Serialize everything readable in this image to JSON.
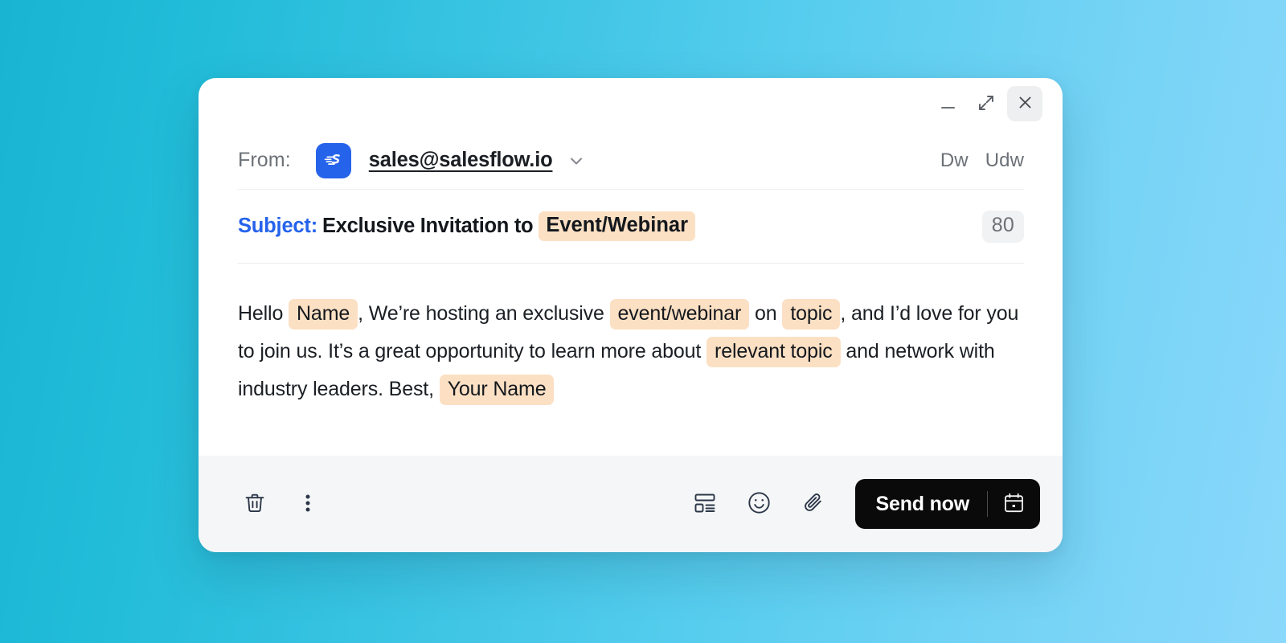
{
  "background": {
    "gradient_from": "#18b4d2",
    "gradient_to": "#8ad8fb"
  },
  "window_controls": {
    "minimize": {
      "name": "minimize",
      "label": "_"
    },
    "expand": {
      "name": "expand",
      "label": "expand-icon"
    },
    "close": {
      "name": "close",
      "label": "close-icon"
    }
  },
  "header": {
    "from_label": "From:",
    "brand_logo_alt": "salesflow-logo",
    "from_email": "sales@salesflow.io",
    "dropdown_icon": "chevron-down-icon",
    "undo_label": "Dw",
    "redo_label": "Udw"
  },
  "subject": {
    "label": "Subject:",
    "text": "Exclusive Invitation to",
    "token": "Event/Webinar",
    "char_count": "80"
  },
  "body": {
    "segments": [
      {
        "type": "text",
        "value": "Hello "
      },
      {
        "type": "token",
        "value": "Name"
      },
      {
        "type": "text",
        "value": ", We’re hosting an exclusive "
      },
      {
        "type": "token",
        "value": "event/webinar"
      },
      {
        "type": "text",
        "value": " on "
      },
      {
        "type": "token",
        "value": "topic"
      },
      {
        "type": "text",
        "value": ", and I’d love for you to join us. It’s a great opportunity to learn more about "
      },
      {
        "type": "token",
        "value": "relevant topic"
      },
      {
        "type": "text",
        "value": " and network with industry leaders. Best, "
      },
      {
        "type": "token",
        "value": "Your Name"
      }
    ],
    "plain_text": "Hello Name , We’re hosting an exclusive event/webinar on topic , and I’d love for you to join us. It’s a great opportunity to learn more about relevant topic and network with industry leaders. Best, Your Name"
  },
  "footer": {
    "left_tools": [
      {
        "name": "discard-draft",
        "icon": "trash-icon"
      },
      {
        "name": "more-options",
        "icon": "more-vertical-icon"
      }
    ],
    "right_tools": [
      {
        "name": "insert-template",
        "icon": "template-icon"
      },
      {
        "name": "insert-emoji",
        "icon": "smiley-icon"
      },
      {
        "name": "attach-file",
        "icon": "paperclip-icon"
      }
    ],
    "send_label": "Send now",
    "schedule_icon": "calendar-icon"
  },
  "colors": {
    "token_highlight": "#fce0c4",
    "subject_accent": "#2563eb",
    "send_button": "#0a0a0a",
    "brand_blue": "#2563eb",
    "footer_bg": "#f5f6f7"
  }
}
